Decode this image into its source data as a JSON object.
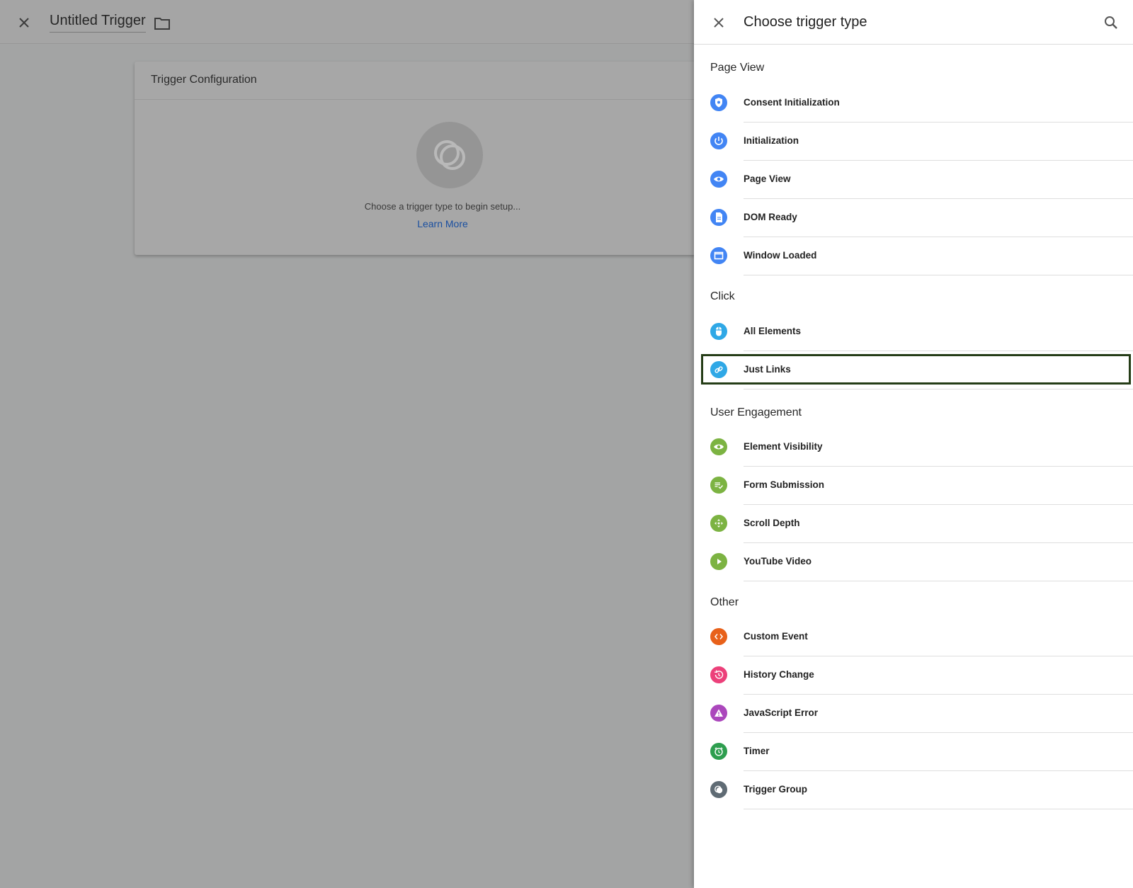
{
  "editor": {
    "title": "Untitled Trigger",
    "card_header": "Trigger Configuration",
    "empty_text": "Choose a trigger type to begin setup...",
    "learn_more": "Learn More"
  },
  "panel": {
    "title": "Choose trigger type",
    "sections": {
      "page_view": {
        "title": "Page View",
        "items": [
          {
            "label": "Consent Initialization",
            "icon": "shield-icon",
            "color": "#4285f4"
          },
          {
            "label": "Initialization",
            "icon": "power-icon",
            "color": "#4285f4"
          },
          {
            "label": "Page View",
            "icon": "eye-icon",
            "color": "#4285f4"
          },
          {
            "label": "DOM Ready",
            "icon": "document-icon",
            "color": "#4285f4"
          },
          {
            "label": "Window Loaded",
            "icon": "window-icon",
            "color": "#4285f4"
          }
        ]
      },
      "click": {
        "title": "Click",
        "items": [
          {
            "label": "All Elements",
            "icon": "mouse-icon",
            "color": "#2fa8e6"
          },
          {
            "label": "Just Links",
            "icon": "link-icon",
            "color": "#2fa8e6"
          }
        ]
      },
      "user_engagement": {
        "title": "User Engagement",
        "items": [
          {
            "label": "Element Visibility",
            "icon": "eye-icon",
            "color": "#7cb342"
          },
          {
            "label": "Form Submission",
            "icon": "form-check-icon",
            "color": "#7cb342"
          },
          {
            "label": "Scroll Depth",
            "icon": "move-icon",
            "color": "#7cb342"
          },
          {
            "label": "YouTube Video",
            "icon": "play-icon",
            "color": "#7cb342"
          }
        ]
      },
      "other": {
        "title": "Other",
        "items": [
          {
            "label": "Custom Event",
            "icon": "code-icon",
            "color": "#e8611a"
          },
          {
            "label": "History Change",
            "icon": "history-icon",
            "color": "#ec407a"
          },
          {
            "label": "JavaScript Error",
            "icon": "warning-icon",
            "color": "#ab47bc"
          },
          {
            "label": "Timer",
            "icon": "alarm-icon",
            "color": "#2e9e4f"
          },
          {
            "label": "Trigger Group",
            "icon": "trigger-group-icon",
            "color": "#5f6b74"
          }
        ]
      }
    },
    "highlight_color": "#253d17"
  }
}
